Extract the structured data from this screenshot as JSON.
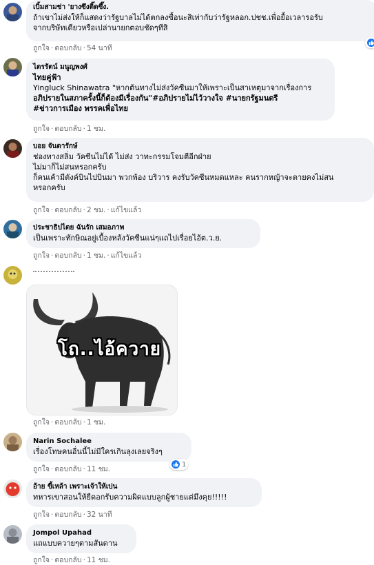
{
  "comments": [
    {
      "author": "เบิ้มสามช่า 'ยางซึงติ๊ดซึ๊ง.",
      "lines": [
        "ถ้าเขาไม่ส่งให้ก็แสดงว่ารัฐบาลไม่ได้ตกลงซื้อนะสิเท่ากับว่ารัฐหลอก.ปชช.เพื่อยื้อเวลารอรับ",
        "จากบริษัทเดียวหรือเปล่านายกตอบชัดๆทีสิ"
      ],
      "like": "ถูกใจ",
      "reply": "ตอบกลับ",
      "time": "54 นาที"
    },
    {
      "author": "ไตรรัตน์ มนูญพงศ์",
      "lines": [
        "ไทยคู่ฟ้า",
        "Yingluck Shinawatra \"หากต้นทางไม่ส่งวัคซีนมาให้เพราะเป็นสาเหตุมาจากเรื่องการ",
        "อภิปรายในสภาครั้งนี้ก็ต้องมีเรื่องกัน\"#อภิปรายไม่ไว้วางใจ #นายกรัฐมนตรี",
        "#ข่าวการเมือง พรรคเพื่อไทย"
      ],
      "like": "ถูกใจ",
      "reply": "ตอบกลับ",
      "time": "1 ชม."
    },
    {
      "author": "บอย จันดารักษ์",
      "lines": [
        "ช่องทางสลิ่ม วัคซีนไม่ได้ ไม่ส่ง วาทะกรรมโจมตีอีกฝ่าย",
        "ไม่มาก็ไม่สนหรอกครับ",
        "ก็คนเค้ามีตังค์บินไปบินมา พวกพ้อง บริวาร คงรับวัคซีนหมดแหละ คนรากหญ้าจะตายคงไม่สน",
        "หรอกครับ"
      ],
      "like": "ถูกใจ",
      "reply": "ตอบกลับ",
      "time": "2 ชม.",
      "edited": "แก้ไขแล้ว"
    },
    {
      "author": "ประชาธิปไตย ฉันรัก เสมอภาพ",
      "lines": [
        "เป็นเพราะทักษิณอยู่เบื้องหลังวัคซีนแน่ๆแถไปเรื่อยไอ้ต.ว.ย."
      ],
      "like": "ถูกใจ",
      "reply": "ตอบกลับ",
      "time": "1 ชม.",
      "edited": "แก้ไขแล้ว"
    },
    {
      "author": "",
      "image_caption": "โถ..ไอ้ควาย",
      "like": "ถูกใจ",
      "reply": "ตอบกลับ",
      "time": "1 ชม."
    },
    {
      "author": "Narin Sochalee",
      "lines": [
        "เรื่องโทษคนอื่นนี้ไม่มีใครเกินลุงเลยจริงๆ"
      ],
      "like": "ถูกใจ",
      "reply": "ตอบกลับ",
      "time": "11 ชม.",
      "reaction_count": "1"
    },
    {
      "author": "อ้าย ขี้เหล้า เพราะเจ้าให้เปน",
      "lines": [
        "ทหารเขาสอนให้ยืดอกรับความผิดแบบลูกผู้ชายแต่มึงคุย!!!!!"
      ],
      "like": "ถูกใจ",
      "reply": "ตอบกลับ",
      "time": "32 นาที"
    },
    {
      "author": "Jompol Upahad",
      "lines": [
        "แถแบบควายๆตามสันดาน"
      ],
      "like": "ถูกใจ",
      "reply": "ตอบกลับ",
      "time": "11 ชม."
    }
  ],
  "top_reaction_count": "",
  "colors": {
    "bubble": "#f0f2f5",
    "meta_text": "#65676b",
    "like_blue": "#1877f2"
  }
}
